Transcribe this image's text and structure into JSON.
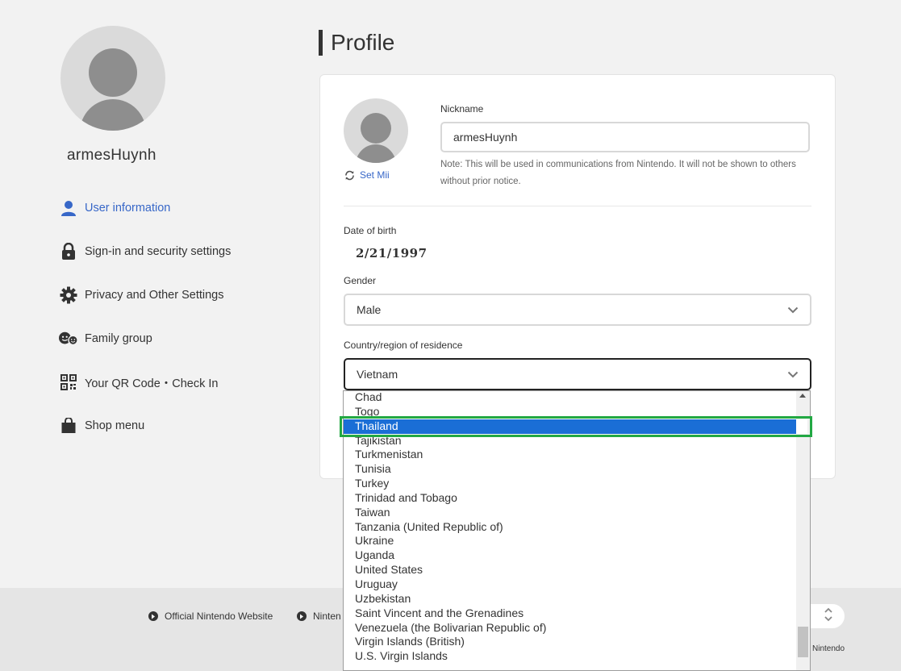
{
  "sidebar": {
    "username": "armesHuynh",
    "items": [
      {
        "label": "User information",
        "icon": "person-icon",
        "active": true
      },
      {
        "label": "Sign-in and security settings",
        "icon": "lock-icon",
        "active": false
      },
      {
        "label": "Privacy and Other Settings",
        "icon": "gear-icon",
        "active": false
      },
      {
        "label": "Family group",
        "icon": "family-icon",
        "active": false
      },
      {
        "label": "Your QR Code・Check In",
        "icon": "qr-code-icon",
        "active": false
      },
      {
        "label": "Shop menu",
        "icon": "shopping-bag-icon",
        "active": false
      }
    ]
  },
  "main": {
    "title": "Profile",
    "set_mii_label": "Set Mii",
    "nickname": {
      "label": "Nickname",
      "value": "armesHuynh",
      "note": "Note: This will be used in communications from Nintendo. It will not be shown to others without prior notice."
    },
    "dob": {
      "label": "Date of birth",
      "value": "2/21/1997"
    },
    "gender": {
      "label": "Gender",
      "value": "Male"
    },
    "country": {
      "label": "Country/region of residence",
      "value": "Vietnam"
    }
  },
  "dropdown": {
    "options": [
      "Chad",
      "Togo",
      "Thailand",
      "Tajikistan",
      "Turkmenistan",
      "Tunisia",
      "Turkey",
      "Trinidad and Tobago",
      "Taiwan",
      "Tanzania (United Republic of)",
      "Ukraine",
      "Uganda",
      "United States",
      "Uruguay",
      "Uzbekistan",
      "Saint Vincent and the Grenadines",
      "Venezuela (the Bolivarian Republic of)",
      "Virgin Islands (British)",
      "U.S. Virgin Islands"
    ],
    "selected": "Thailand",
    "highlight_color": "#22a843",
    "selected_color": "#1a6ed6"
  },
  "footer": {
    "links": [
      "Official Nintendo Website",
      "Ninten"
    ],
    "copyright": "Nintendo"
  },
  "colors": {
    "accent": "#3767c8"
  }
}
